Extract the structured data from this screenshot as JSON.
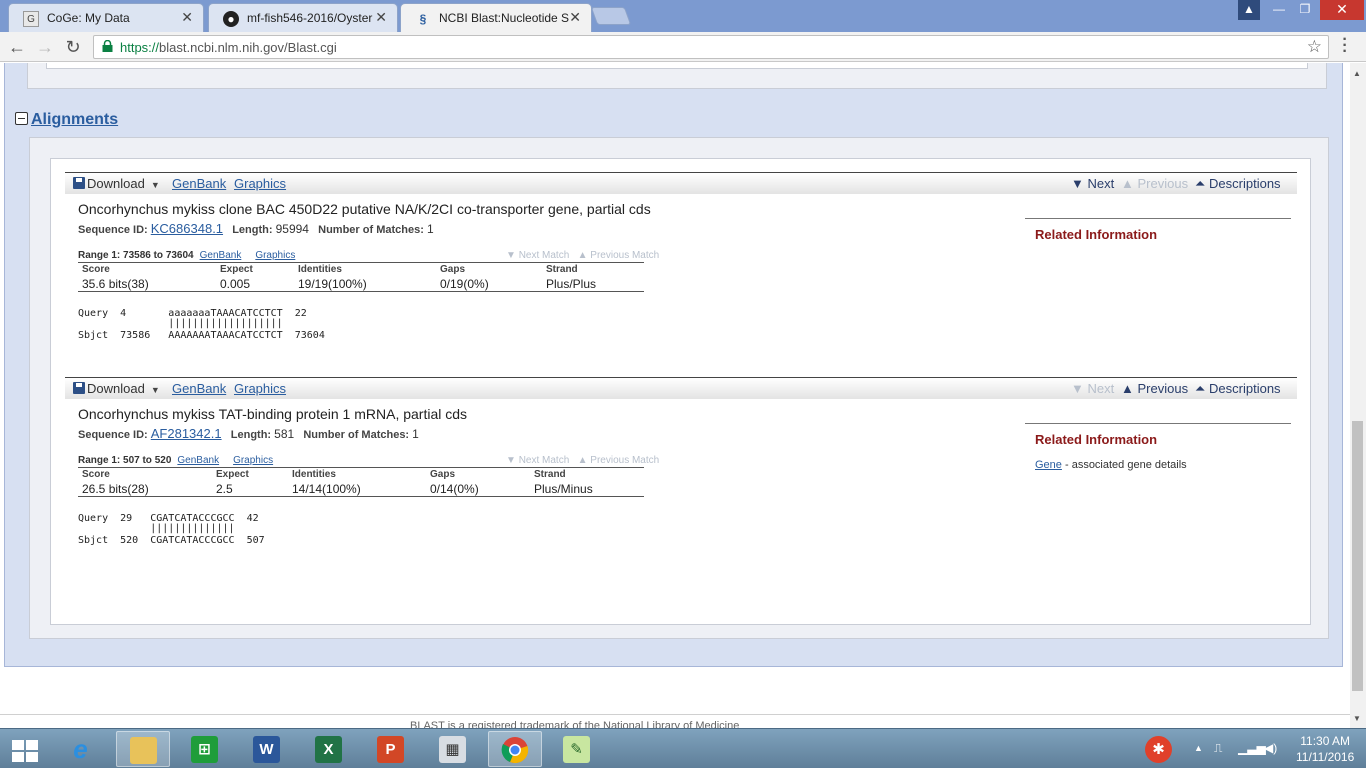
{
  "browser": {
    "tabs": [
      {
        "title": "CoGe: My Data",
        "icon": "coge-icon"
      },
      {
        "title": "mf-fish546-2016/Oyster",
        "icon": "github-icon"
      },
      {
        "title": "NCBI Blast:Nucleotide Se",
        "icon": "ncbi-icon"
      }
    ],
    "url_protocol": "https://",
    "url_rest": "blast.ncbi.nlm.nih.gov/Blast.cgi"
  },
  "page": {
    "section_title": "Alignments",
    "footer_text": "BLAST is a registered trademark of the National Library of Medicine",
    "hits": [
      {
        "toolbar": {
          "download": "Download",
          "genbank": "GenBank",
          "graphics": "Graphics",
          "next": "Next",
          "previous": "Previous",
          "descriptions": "Descriptions",
          "next_enabled": true,
          "previous_enabled": false
        },
        "title": "Oncorhynchus mykiss clone BAC 450D22 putative NA/K/2CI co-transporter gene, partial cds",
        "sequence_id_label": "Sequence ID:",
        "sequence_id": "KC686348.1",
        "length_label": "Length:",
        "length": "95994",
        "matches_label": "Number of Matches:",
        "matches": "1",
        "range": "Range 1: 73586 to 73604",
        "range_genbank": "GenBank",
        "range_graphics": "Graphics",
        "next_match": "Next Match",
        "previous_match": "Previous Match",
        "stats_headers": [
          "Score",
          "Expect",
          "Identities",
          "Gaps",
          "Strand"
        ],
        "stats_values": [
          "35.6 bits(38)",
          "0.005",
          "19/19(100%)",
          "0/19(0%)",
          "Plus/Plus"
        ],
        "query_line": "Query  4       aaaaaaaTAAACATCCTCT  22",
        "bar_line": "               |||||||||||||||||||",
        "sbjct_line": "Sbjct  73586   AAAAAAATAAACATCCTCT  73604",
        "related_title": "Related Information",
        "related_links": []
      },
      {
        "toolbar": {
          "download": "Download",
          "genbank": "GenBank",
          "graphics": "Graphics",
          "next": "Next",
          "previous": "Previous",
          "descriptions": "Descriptions",
          "next_enabled": false,
          "previous_enabled": true
        },
        "title": "Oncorhynchus mykiss TAT-binding protein 1 mRNA, partial cds",
        "sequence_id_label": "Sequence ID:",
        "sequence_id": "AF281342.1",
        "length_label": "Length:",
        "length": "581",
        "matches_label": "Number of Matches:",
        "matches": "1",
        "range": "Range 1: 507 to 520",
        "range_genbank": "GenBank",
        "range_graphics": "Graphics",
        "next_match": "Next Match",
        "previous_match": "Previous Match",
        "stats_headers": [
          "Score",
          "Expect",
          "Identities",
          "Gaps",
          "Strand"
        ],
        "stats_values": [
          "26.5 bits(28)",
          "2.5",
          "14/14(100%)",
          "0/14(0%)",
          "Plus/Minus"
        ],
        "query_line": "Query  29   CGATCATACCCGCC  42",
        "bar_line": "            ||||||||||||||",
        "sbjct_line": "Sbjct  520  CGATCATACCCGCC  507",
        "related_title": "Related Information",
        "related_links": [
          {
            "label": "Gene",
            "desc": " - associated gene details"
          }
        ]
      }
    ]
  },
  "taskbar": {
    "apps": [
      "start-button",
      "internet-explorer",
      "file-explorer",
      "store",
      "word",
      "excel",
      "powerpoint",
      "calculator",
      "chrome",
      "notepad-plus"
    ],
    "time": "11:30 AM",
    "date": "11/11/2016"
  },
  "colors": {
    "tab_strip": "#7c9ad0",
    "page_band": "#d7e0f2",
    "related_heading": "#8b1a1a",
    "link": "#2a5d9f"
  }
}
